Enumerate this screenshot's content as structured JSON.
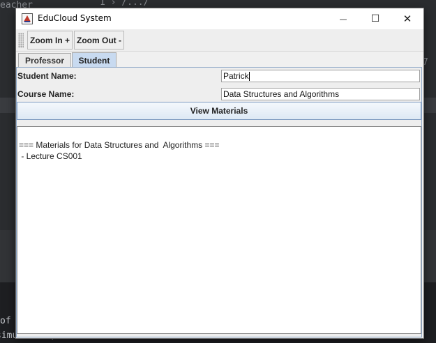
{
  "background": {
    "top_left_text": "eacher",
    "path_text": "1  ›  /.../",
    "right_text": "7",
    "bottom_line1": "of",
    "bottom_line2": "simulation)."
  },
  "window": {
    "title": "EduCloud System",
    "controls": {
      "minimize": "—",
      "maximize": "☐",
      "close": "✕"
    }
  },
  "toolbar": {
    "zoom_in_label": "Zoom In +",
    "zoom_out_label": "Zoom Out -"
  },
  "tabs": [
    {
      "label": "Professor",
      "selected": false
    },
    {
      "label": "Student",
      "selected": true
    }
  ],
  "form": {
    "student_name_label": "Student Name:",
    "student_name_value": "Patrick",
    "course_name_label": "Course Name:",
    "course_name_value": "Data Structures and  Algorithms",
    "view_button_label": "View Materials"
  },
  "output": {
    "lines": [
      "=== Materials for Data Structures and  Algorithms ===",
      " - Lecture CS001"
    ]
  },
  "colors": {
    "tab_selected": "#c8daf0",
    "button_border": "#7f9bc0",
    "ide_background": "#2b2d30"
  }
}
